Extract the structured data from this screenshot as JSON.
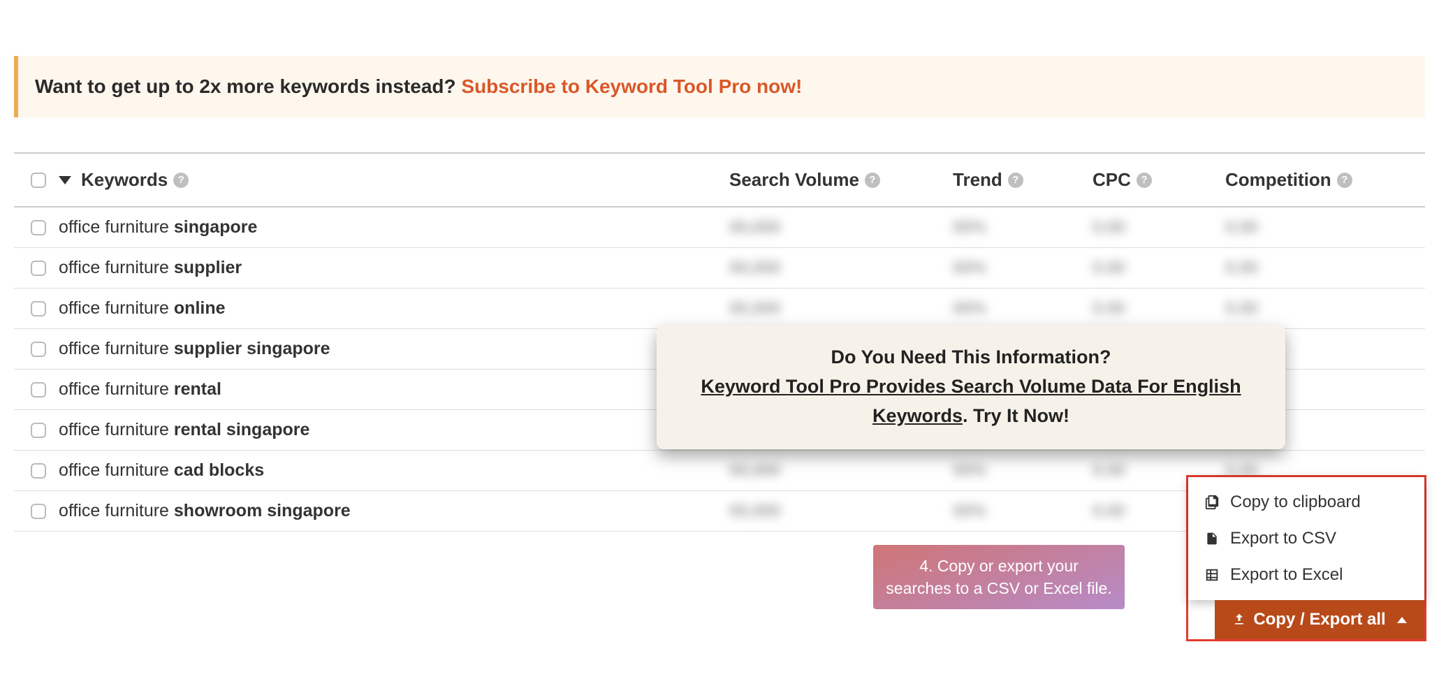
{
  "banner": {
    "text": "Want to get up to 2x more keywords instead? ",
    "cta": "Subscribe to Keyword Tool Pro now!"
  },
  "columns": {
    "keywords": "Keywords",
    "search_volume": "Search Volume",
    "trend": "Trend",
    "cpc": "CPC",
    "competition": "Competition"
  },
  "keyword_prefix": "office furniture ",
  "rows": [
    {
      "suffix": "singapore"
    },
    {
      "suffix": "supplier"
    },
    {
      "suffix": "online"
    },
    {
      "suffix": "supplier singapore"
    },
    {
      "suffix": "rental"
    },
    {
      "suffix": "rental singapore"
    },
    {
      "suffix": "cad blocks"
    },
    {
      "suffix": "showroom singapore"
    }
  ],
  "popup": {
    "line1": "Do You Need This Information?",
    "line2a": "Keyword Tool Pro Provides Search Volume Data For English Keywords",
    "line2b": ". Try It Now!"
  },
  "hint": {
    "text": "4. Copy or export your searches to a CSV or Excel file."
  },
  "export": {
    "copy": "Copy to clipboard",
    "csv": "Export to CSV",
    "excel": "Export to Excel",
    "all": "Copy / Export all"
  }
}
